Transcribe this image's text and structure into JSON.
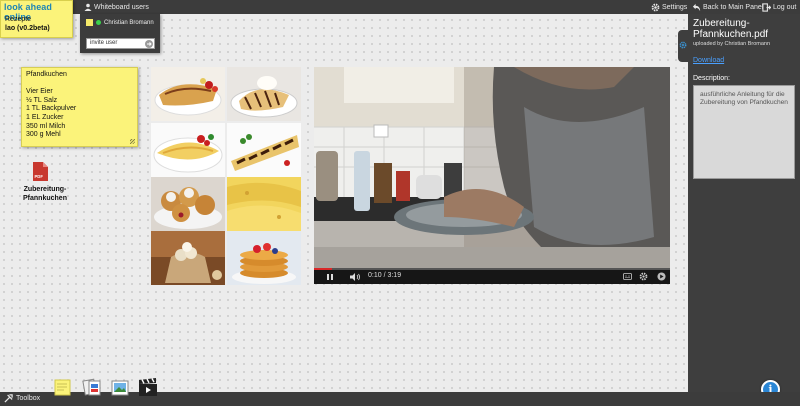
{
  "app": {
    "logo_title": "look ahead online",
    "board_name": "Rezepte",
    "version": "lao (v0.2beta)"
  },
  "topbar": {
    "whiteboard_users": "Whiteboard users",
    "settings": "Settings",
    "back": "Back to Main Panel",
    "logout": "Log out"
  },
  "users_panel": {
    "user_name": "Christian Bromann",
    "invite_placeholder": "invite user"
  },
  "note": {
    "lines": [
      "Pfandkuchen",
      "",
      "Vier Eier",
      "½ TL Salz",
      "1 TL Backpulver",
      "1 EL Zucker",
      "350 ml Milch",
      "300 g Mehl"
    ]
  },
  "file": {
    "badge": "PDF",
    "label_line1": "Zubereitung-",
    "label_line2": "Pfannkuchen"
  },
  "video": {
    "time": "0:10 / 3:19",
    "progress": 0.05
  },
  "panel": {
    "title_line1": "Zubereitung-",
    "title_line2": "Pfannkuchen.pdf",
    "uploaded_by": "uploaded by Christian Bromann",
    "download": "Download",
    "description_label": "Description:",
    "description": "ausführliche Anleitung für die Zubereitung von Pfandkuchen"
  },
  "bottombar": {
    "toolbox": "Toolbox"
  },
  "colors": {
    "sticky": "#fbf37a",
    "bar": "#3c3c3c",
    "accent": "#2a86d5",
    "link": "#4aa0ff",
    "online": "#3bd14a"
  },
  "icons": [
    "user-icon",
    "gear-icon",
    "back-arrow-icon",
    "logout-icon",
    "pdf-file-icon",
    "play-icon",
    "volume-icon",
    "settings-icon",
    "info-icon",
    "toolbox-icon",
    "sticky-note-tool-icon",
    "files-tool-icon",
    "image-tool-icon",
    "video-tool-icon"
  ]
}
